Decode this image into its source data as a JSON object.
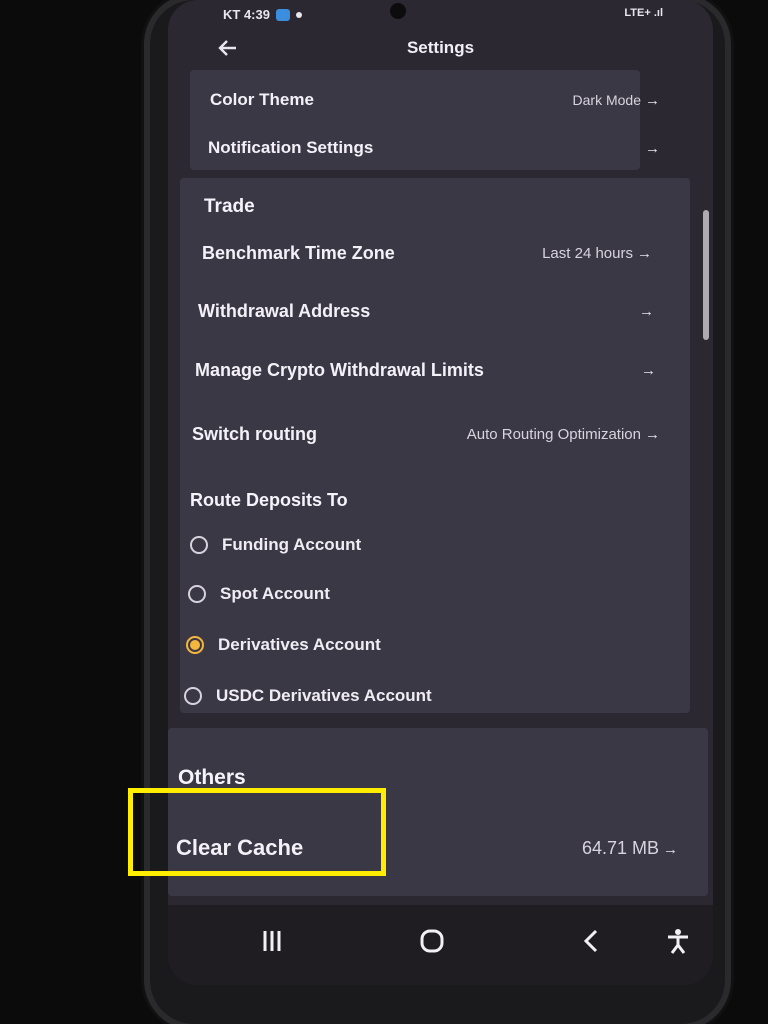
{
  "status_bar": {
    "left_text": "KT 4:39",
    "right_text": "LTE+ .ıl"
  },
  "header": {
    "title": "Settings",
    "back_icon": "arrow-left-icon"
  },
  "general": {
    "items": [
      {
        "label": "Color Theme",
        "value": "Dark Mode"
      },
      {
        "label": "Notification Settings",
        "value": ""
      }
    ]
  },
  "trade": {
    "title": "Trade",
    "items": [
      {
        "label": "Benchmark Time Zone",
        "value": "Last 24 hours"
      },
      {
        "label": "Withdrawal Address",
        "value": ""
      },
      {
        "label": "Manage Crypto Withdrawal Limits",
        "value": ""
      },
      {
        "label": "Switch routing",
        "value": "Auto Routing Optimization"
      }
    ],
    "route_title": "Route Deposits To",
    "route_options": [
      {
        "label": "Funding Account",
        "selected": false
      },
      {
        "label": "Spot Account",
        "selected": false
      },
      {
        "label": "Derivatives Account",
        "selected": true
      },
      {
        "label": "USDC Derivatives Account",
        "selected": false
      }
    ]
  },
  "others": {
    "title": "Others",
    "items": [
      {
        "label": "Clear Cache",
        "value": "64.71 MB"
      }
    ]
  },
  "arrow_glyph": "→",
  "accent_color": "#f4b63c",
  "highlight_color": "#ffee00",
  "nav": {
    "recent_icon": "|||",
    "home_icon": "O",
    "back_icon": "<",
    "accessibility_icon": "accessibility-icon"
  }
}
